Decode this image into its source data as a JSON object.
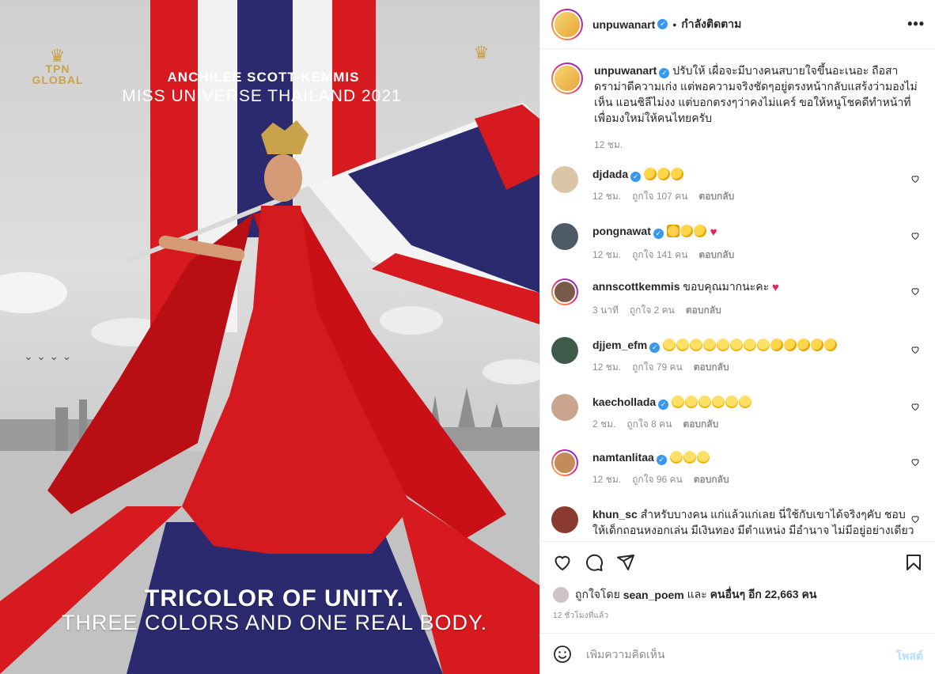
{
  "poster": {
    "brand_left": "TPN GLOBAL",
    "name": "ANCHILEE SCOTT-KEMMIS",
    "title": "MISS UNIVERSE THAILAND 2021",
    "headline": "TRICOLOR OF UNITY.",
    "subline": "THREE COLORS AND ONE REAL BODY."
  },
  "header": {
    "username": "unpuwanart",
    "separator": "•",
    "follow_label": "กำลังติดตาม",
    "more_icon": "more-icon"
  },
  "caption": {
    "username": "unpuwanart",
    "text": "ปรับให้ เผื่อจะมีบางคนสบายใจขึ้นอะเนอะ ถือสาดราม่าดีความเก่ง แต่พอความจริงชัดๆอยู่ตรงหน้ากลับแสร้งว่ามองไม่เห็น แอนชิลีไม่งง แต่บอกตรงๆว่าคงไม่แคร์ ขอให้หนูโชคดีทำหน้าที่เพื่อมงใหม่ให้คนไทยครับ",
    "time": "12 ชม."
  },
  "comments": [
    {
      "username": "djdada",
      "verified": true,
      "text": "",
      "emojis": [
        "clap",
        "clap",
        "clap"
      ],
      "time": "12 ชม.",
      "likes": "ถูกใจ 107 คน",
      "reply": "ตอบกลับ"
    },
    {
      "username": "pongnawat",
      "verified": true,
      "text": "",
      "emojis": [
        "thumb",
        "clap",
        "clap",
        "heart"
      ],
      "time": "12 ชม.",
      "likes": "ถูกใจ 141 คน",
      "reply": "ตอบกลับ"
    },
    {
      "username": "annscottkemmis",
      "verified": false,
      "text": "ขอบคุณมากนะคะ",
      "emojis": [
        "heart"
      ],
      "time": "3 นาที",
      "likes": "ถูกใจ 2 คน",
      "reply": "ตอบกลับ"
    },
    {
      "username": "djjem_efm",
      "verified": true,
      "text": "",
      "emojis": [
        "laugh",
        "laugh",
        "laugh",
        "laugh",
        "laugh",
        "laugh",
        "laugh",
        "laugh",
        "clap",
        "clap",
        "clap",
        "clap",
        "clap"
      ],
      "time": "12 ชม.",
      "likes": "ถูกใจ 79 คน",
      "reply": "ตอบกลับ"
    },
    {
      "username": "kaechollada",
      "verified": true,
      "text": "",
      "emojis": [
        "laugh",
        "laugh",
        "laugh",
        "laugh",
        "laugh",
        "laugh"
      ],
      "time": "2 ชม.",
      "likes": "ถูกใจ 8 คน",
      "reply": "ตอบกลับ"
    },
    {
      "username": "namtanlitaa",
      "verified": true,
      "text": "",
      "emojis": [
        "laugh",
        "laugh",
        "laugh"
      ],
      "time": "12 ชม.",
      "likes": "ถูกใจ 96 คน",
      "reply": "ตอบกลับ"
    },
    {
      "username": "khun_sc",
      "verified": false,
      "text": "สำหรับบางคน แก่แล้วแก่เลย นี่ใช้กับเขาได้จริงๆคับ ชอบให้เด็กถอนหงอกเล่น มีเงินทอง มีตำแหน่ง มีอำนาจ ไม่มีอยู่อย่างเดียวคือ",
      "emojis": [],
      "time": "",
      "likes": "",
      "reply": ""
    }
  ],
  "actions": {
    "like_icon": "heart-icon",
    "comment_icon": "comment-icon",
    "share_icon": "share-icon",
    "save_icon": "bookmark-icon",
    "likes_prefix": "ถูกใจโดย",
    "likes_user": "sean_poem",
    "likes_and": "และ",
    "likes_others": "คนอื่นๆ อีก 22,663 คน",
    "posted": "12 ชั่วโมงที่แล้ว"
  },
  "add_comment": {
    "emoji_icon": "smile-icon",
    "placeholder": "เพิ่มความคิดเห็น",
    "post_label": "โพสต์"
  },
  "colors": {
    "thai_red": "#d71920",
    "thai_blue": "#2b2a6e",
    "verified_blue": "#3897f0",
    "link_light": "#b2dffc"
  }
}
